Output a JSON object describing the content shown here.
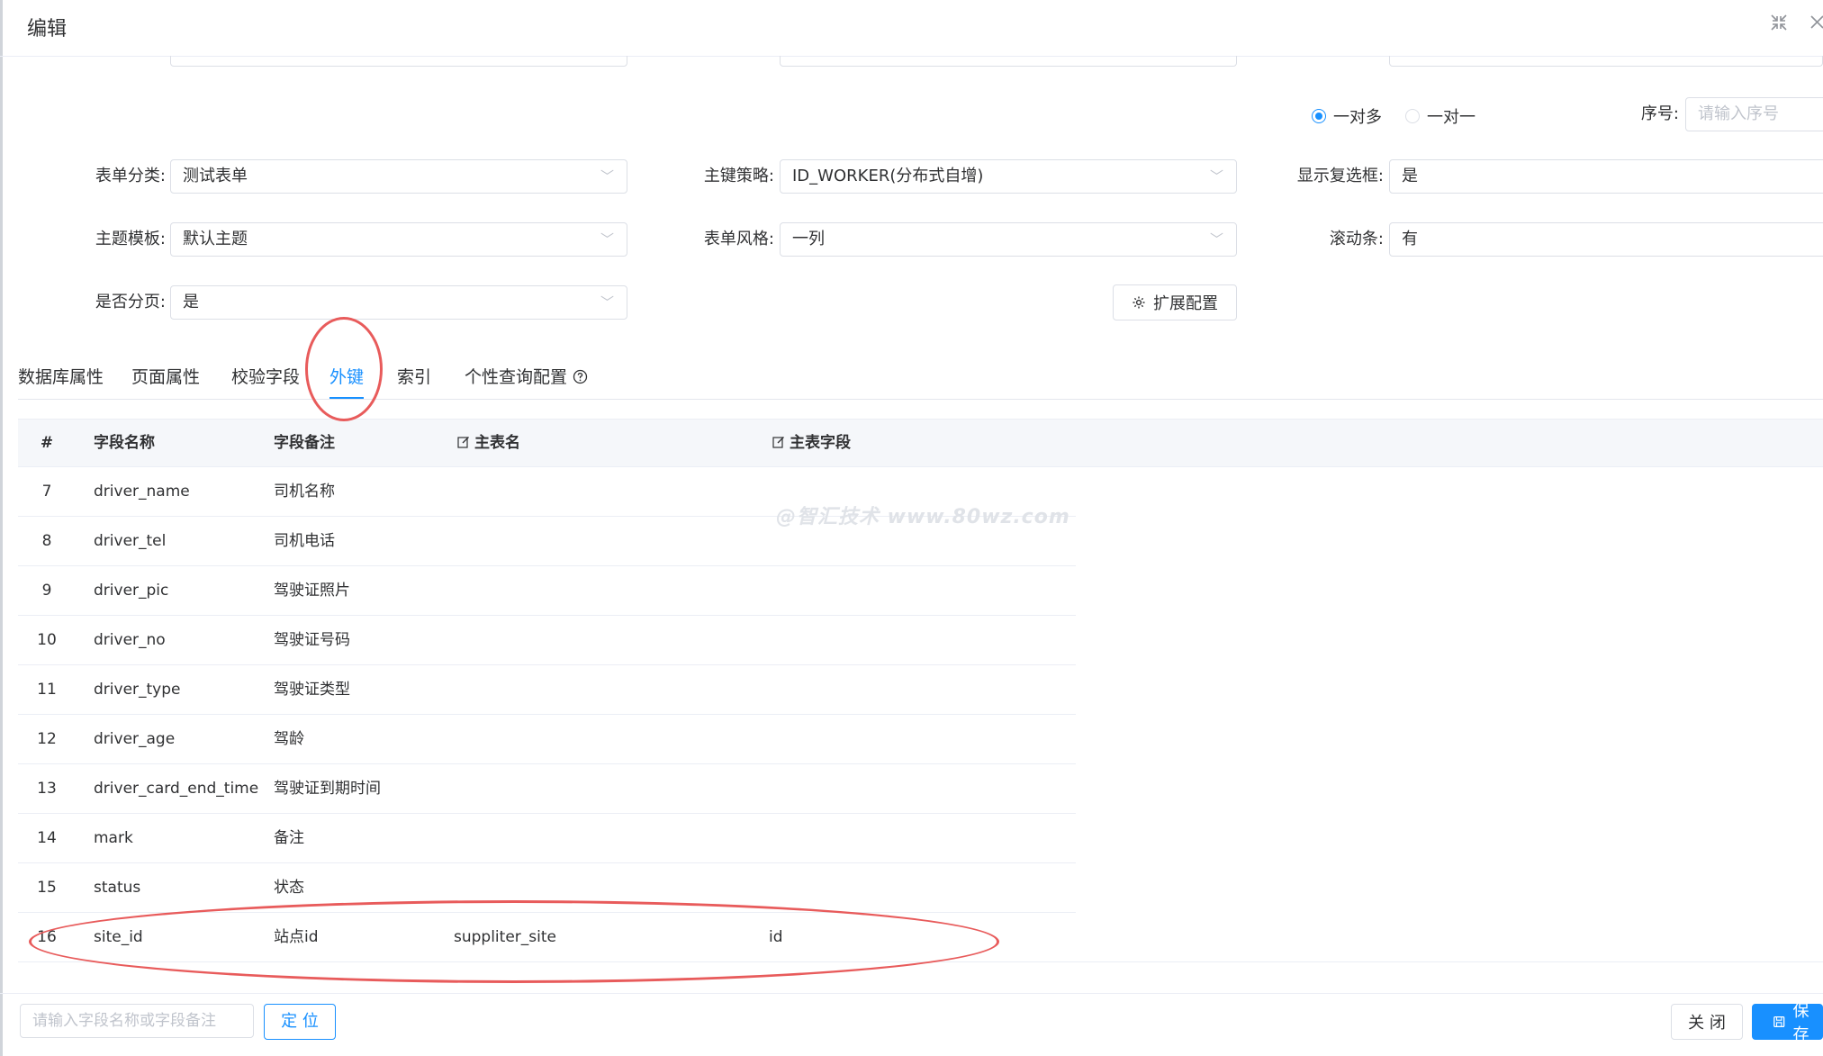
{
  "dialog": {
    "title": "编辑"
  },
  "relation": {
    "options": [
      {
        "label": "一对多",
        "selected": true
      },
      {
        "label": "一对一",
        "selected": false
      }
    ]
  },
  "order": {
    "label": "序号:",
    "placeholder": "请输入序号"
  },
  "form": {
    "category": {
      "label": "表单分类:",
      "value": "测试表单"
    },
    "pk_strategy": {
      "label": "主键策略:",
      "value": "ID_WORKER(分布式自增)"
    },
    "show_checkbox": {
      "label": "显示复选框:",
      "value": "是"
    },
    "theme": {
      "label": "主题模板:",
      "value": "默认主题"
    },
    "style": {
      "label": "表单风格:",
      "value": "一列"
    },
    "scrollbar": {
      "label": "滚动条:",
      "value": "有"
    },
    "paging": {
      "label": "是否分页:",
      "value": "是"
    },
    "extend_button": "扩展配置"
  },
  "tabs": [
    {
      "label": "数据库属性",
      "active": false
    },
    {
      "label": "页面属性",
      "active": false
    },
    {
      "label": "校验字段",
      "active": false
    },
    {
      "label": "外键",
      "active": true
    },
    {
      "label": "索引",
      "active": false
    },
    {
      "label": "个性查询配置",
      "active": false
    }
  ],
  "table": {
    "headers": [
      "#",
      "字段名称",
      "字段备注",
      "主表名",
      "主表字段"
    ],
    "rows": [
      {
        "num": "7",
        "name": "driver_name",
        "comment": "司机名称",
        "main_table": "",
        "main_field": ""
      },
      {
        "num": "8",
        "name": "driver_tel",
        "comment": "司机电话",
        "main_table": "",
        "main_field": ""
      },
      {
        "num": "9",
        "name": "driver_pic",
        "comment": "驾驶证照片",
        "main_table": "",
        "main_field": ""
      },
      {
        "num": "10",
        "name": "driver_no",
        "comment": "驾驶证号码",
        "main_table": "",
        "main_field": ""
      },
      {
        "num": "11",
        "name": "driver_type",
        "comment": "驾驶证类型",
        "main_table": "",
        "main_field": ""
      },
      {
        "num": "12",
        "name": "driver_age",
        "comment": "驾龄",
        "main_table": "",
        "main_field": ""
      },
      {
        "num": "13",
        "name": "driver_card_end_time",
        "comment": "驾驶证到期时间",
        "main_table": "",
        "main_field": ""
      },
      {
        "num": "14",
        "name": "mark",
        "comment": "备注",
        "main_table": "",
        "main_field": ""
      },
      {
        "num": "15",
        "name": "status",
        "comment": "状态",
        "main_table": "",
        "main_field": ""
      },
      {
        "num": "16",
        "name": "site_id",
        "comment": "站点id",
        "main_table": "suppliter_site",
        "main_field": "id"
      }
    ]
  },
  "watermark": "@智汇技术 www.80wz.com",
  "footer": {
    "search_placeholder": "请输入字段名称或字段备注",
    "locate_button": "定 位",
    "close_button": "关 闭",
    "save_button": "保存"
  },
  "colors": {
    "primary": "#1890ff",
    "annotation": "#e85b5b",
    "border": "#dcdfe6"
  }
}
